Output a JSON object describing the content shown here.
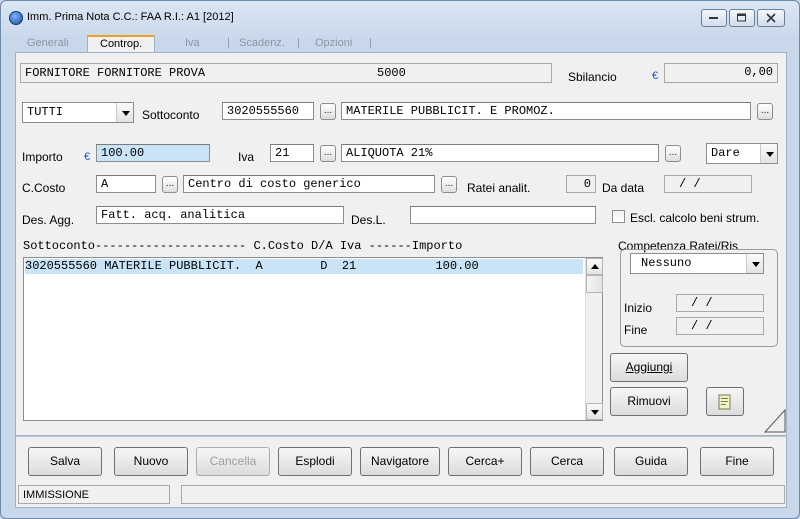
{
  "window": {
    "title": "Imm. Prima Nota C.C.: FAA  R.I.: A1  [2012]",
    "icon": "app-globe-icon"
  },
  "tabs": [
    {
      "label": "Generali"
    },
    {
      "label": "Controp."
    },
    {
      "label": "Iva"
    },
    {
      "label": "Scadenz."
    },
    {
      "label": "Opzioni"
    }
  ],
  "header": {
    "supplier": "FORNITORE  FORNITORE PROVA",
    "supplier_code": "5000",
    "sbilancio_label": "Sbilancio",
    "currency_symbol": "€",
    "sbilancio_value": "0,00"
  },
  "row_sottoconto": {
    "filter_value": "TUTTI",
    "label": "Sottoconto",
    "code": "3020555560",
    "description": "MATERILE PUBBLICIT. E PROMOZ."
  },
  "row_importo": {
    "label": "Importo",
    "currency_symbol": "€",
    "value": "100.00",
    "iva_label": "Iva",
    "iva_code": "21",
    "iva_description": "ALIQUOTA 21%",
    "dare_avere": "Dare"
  },
  "row_costo": {
    "label": "C.Costo",
    "code": "A",
    "description": "Centro di costo generico",
    "ratei_label": "Ratei analit.",
    "ratei_value": "0",
    "da_data_label": "Da data",
    "da_data_value": " /  /"
  },
  "row_desagg": {
    "label": "Des. Agg.",
    "value": "Fatt. acq. analitica",
    "desl_label": "Des.L.",
    "desl_value": "",
    "escl_label": "Escl. calcolo beni strum."
  },
  "grid": {
    "header": "Sottoconto--------------------- C.Costo D/A  Iva  ------Importo",
    "rows": [
      {
        "text": "3020555560 MATERILE PUBBLICIT.  A        D  21           100.00"
      }
    ]
  },
  "competenza": {
    "label": "Competenza Ratei/Ris",
    "value": "Nessuno",
    "inizio_label": "Inizio",
    "inizio_value": " /  /",
    "fine_label": "Fine",
    "fine_value": " /  /"
  },
  "side_buttons": {
    "aggiungi": "Aggiungi",
    "rimuovi": "Rimuovi"
  },
  "footer_buttons": [
    {
      "label": "Salva"
    },
    {
      "label": "Nuovo"
    },
    {
      "label": "Cancella"
    },
    {
      "label": "Esplodi"
    },
    {
      "label": "Navigatore"
    },
    {
      "label": "Cerca+"
    },
    {
      "label": "Cerca"
    },
    {
      "label": "Guida"
    },
    {
      "label": "Fine"
    }
  ],
  "status": {
    "mode": "IMMISSIONE",
    "message": ""
  },
  "colors": {
    "selection": "#c9e4f7",
    "active_tab_accent": "#f0a020",
    "euro_symbol": "#1a55c8"
  }
}
